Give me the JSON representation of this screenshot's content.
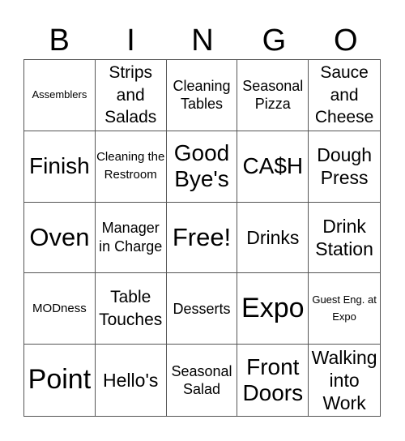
{
  "header": [
    "B",
    "I",
    "N",
    "G",
    "O"
  ],
  "cells": [
    "Assemblers",
    "Strips and Salads",
    "Cleaning Tables",
    "Seasonal Pizza",
    "Sauce and Cheese",
    "Finish",
    "Cleaning the Restroom",
    "Good Bye's",
    "CA$H",
    "Dough Press",
    "Oven",
    "Manager in Charge",
    "Free!",
    "Drinks",
    "Drink Station",
    "MODness",
    "Table Touches",
    "Desserts",
    "Expo",
    "Guest Eng. at Expo",
    "Point",
    "Hello's",
    "Seasonal Salad",
    "Front Doors",
    "Walking into Work"
  ]
}
